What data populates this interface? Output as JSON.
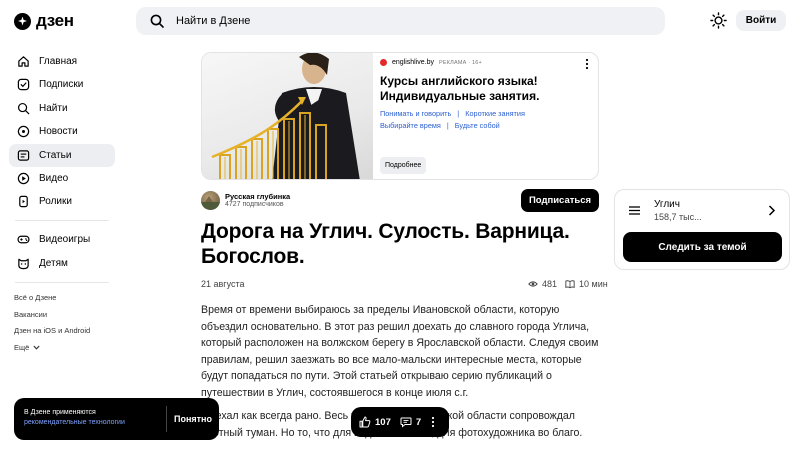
{
  "header": {
    "logo_text": "дзен",
    "search_placeholder": "Найти в Дзене",
    "login_label": "Войти"
  },
  "sidebar": {
    "items": [
      {
        "label": "Главная",
        "icon": "home-icon"
      },
      {
        "label": "Подписки",
        "icon": "subscriptions-icon"
      },
      {
        "label": "Найти",
        "icon": "search-icon"
      },
      {
        "label": "Новости",
        "icon": "news-icon"
      },
      {
        "label": "Статьи",
        "icon": "articles-icon",
        "active": true
      },
      {
        "label": "Видео",
        "icon": "video-icon"
      },
      {
        "label": "Ролики",
        "icon": "clips-icon"
      }
    ],
    "extra_items": [
      {
        "label": "Видеоигры",
        "icon": "gamepad-icon"
      },
      {
        "label": "Детям",
        "icon": "kids-icon"
      }
    ],
    "footer_links": [
      "Всё о Дзене",
      "Вакансии",
      "Дзен на iOS и Android"
    ],
    "more_label": "Ещё"
  },
  "ad": {
    "domain": "englishlive.by",
    "tag": "РЕКЛАМА · 16+",
    "title": "Курсы английского языка! Индивидуальные занятия.",
    "links": [
      "Понимать и говорить",
      "Короткие занятия",
      "Выбирайте время",
      "Будьте собой"
    ],
    "cta": "Подробнее"
  },
  "channel": {
    "name": "Русская глубинка",
    "subscribers": "4727 подписчиков",
    "subscribe_label": "Подписаться"
  },
  "article": {
    "title": "Дорога на Углич. Сулость. Варница. Богослов.",
    "date": "21 августа",
    "views": "481",
    "read_time": "10 мин",
    "paragraph_1": "Время от времени выбираюсь за пределы Ивановской области, которую объездил основательно. В этот раз решил доехать до славного города Углича, который расположен на волжском берегу в Ярославской области. Следуя своим правилам, решил заезжать во все мало-мальски интересные места, которые будут попадаться по пути. Этой статьей открываю серию публикаций о путешествии в Углич, состоявшегося в конце июля с.г.",
    "paragraph_2": "Выехал как всегда рано. Весь участок по Ивановской области сопровождал плотный туман. Но то, что для водителя плохо, для фотохудожника во благо."
  },
  "topic": {
    "name": "Углич",
    "count": "158,7 тыс...",
    "follow_label": "Следить за темой"
  },
  "cookie": {
    "text": "В Дзене применяются",
    "link": "рекомендательные технологии",
    "ok_label": "Понятно"
  },
  "reactions": {
    "likes": "107",
    "comments": "7"
  }
}
